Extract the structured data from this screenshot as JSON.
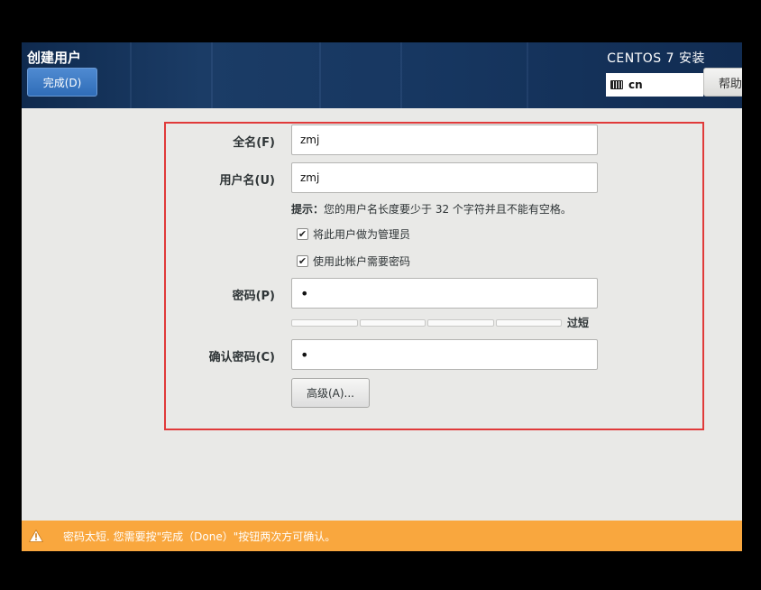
{
  "header": {
    "title": "创建用户",
    "done_label": "完成(D)",
    "product": "CENTOS 7 安装",
    "keyboard_layout": "cn",
    "help_label": "帮助"
  },
  "form": {
    "fullname_label": "全名(F)",
    "fullname_value": "zmj",
    "username_label": "用户名(U)",
    "username_value": "zmj",
    "hint_bold": "提示：",
    "hint_text": "您的用户名长度要少于 32 个字符并且不能有空格。",
    "admin_checkbox_label": "将此用户做为管理员",
    "admin_checked": true,
    "require_password_label": "使用此帐户需要密码",
    "require_password_checked": true,
    "password_label": "密码(P)",
    "password_value": "•",
    "strength_label": "过短",
    "strength_level": 0,
    "confirm_label": "确认密码(C)",
    "confirm_value": "•",
    "advanced_label": "高级(A)..."
  },
  "warning": {
    "text": "密码太短. 您需要按\"完成（Done）\"按钮两次方可确认。"
  },
  "colors": {
    "header_bg": "#173761",
    "done_button": "#3b7bc6",
    "highlight_border": "#e03a3a",
    "warning_bar": "#f9a73e"
  }
}
